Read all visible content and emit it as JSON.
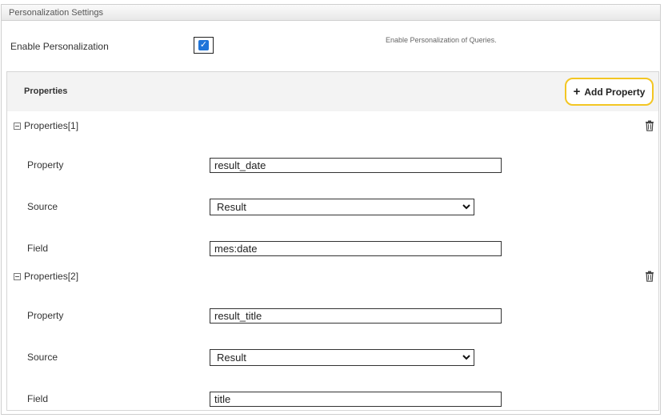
{
  "panel": {
    "title": "Personalization Settings"
  },
  "enable": {
    "label": "Enable Personalization",
    "checked": true,
    "check_glyph": "✓",
    "help": "Enable Personalization of Queries."
  },
  "properties": {
    "title": "Properties",
    "add_button": {
      "icon": "plus-icon",
      "label": "Add Property",
      "plus_glyph": "+"
    },
    "groups": [
      {
        "title": "Properties[1]",
        "property_label": "Property",
        "property_value": "result_date",
        "source_label": "Source",
        "source_value": "Result",
        "field_label": "Field",
        "field_value": "mes:date"
      },
      {
        "title": "Properties[2]",
        "property_label": "Property",
        "property_value": "result_title",
        "source_label": "Source",
        "source_value": "Result",
        "field_label": "Field",
        "field_value": "title"
      }
    ]
  },
  "colors": {
    "accent_border": "#f3c623",
    "checkbox": "#1e74d9"
  }
}
